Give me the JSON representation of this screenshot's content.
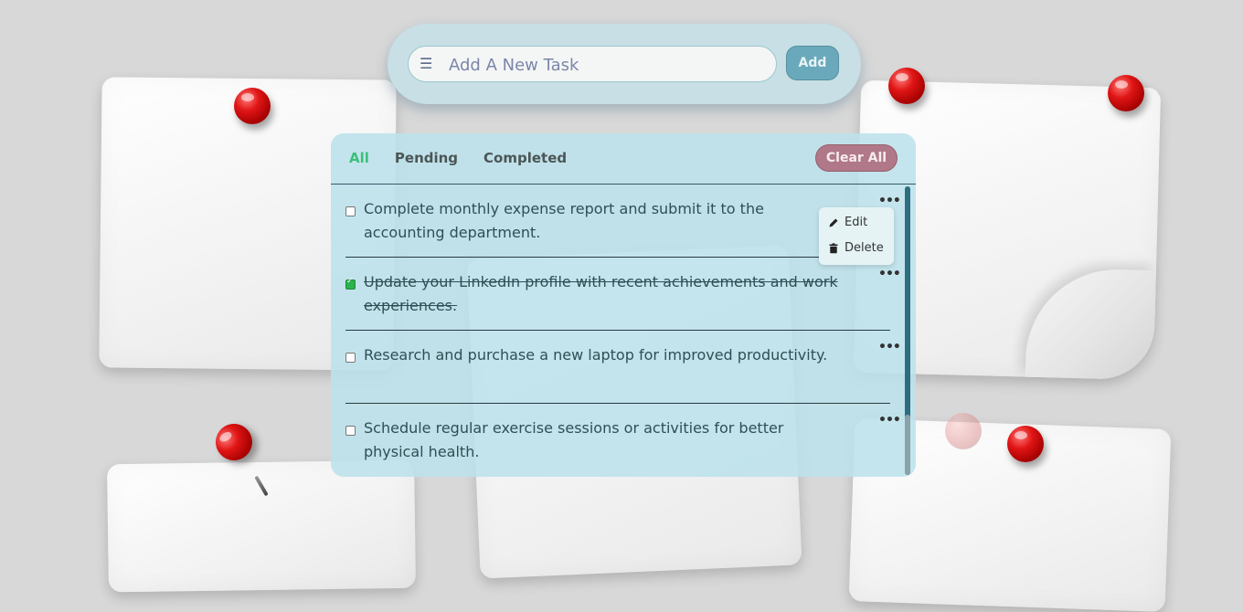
{
  "add_task": {
    "placeholder": "Add A New Task",
    "add_label": "Add"
  },
  "filters": {
    "all": "All",
    "pending": "Pending",
    "completed": "Completed",
    "clear_all": "Clear All"
  },
  "tasks": [
    {
      "text": "Complete monthly expense report and submit it to the accounting department.",
      "done": false
    },
    {
      "text": "Update your LinkedIn profile with recent achievements and work experiences.",
      "done": true
    },
    {
      "text": "Research and purchase a new laptop for improved productivity.",
      "done": false
    },
    {
      "text": "Schedule regular exercise sessions or activities for better physical health.",
      "done": false
    }
  ],
  "context_menu": {
    "edit": "Edit",
    "delete": "Delete"
  },
  "colors": {
    "accent_green": "#3cc07a",
    "add_button": "#69a9bb",
    "clear_button": "#b07888",
    "panel": "#bce1ec"
  }
}
